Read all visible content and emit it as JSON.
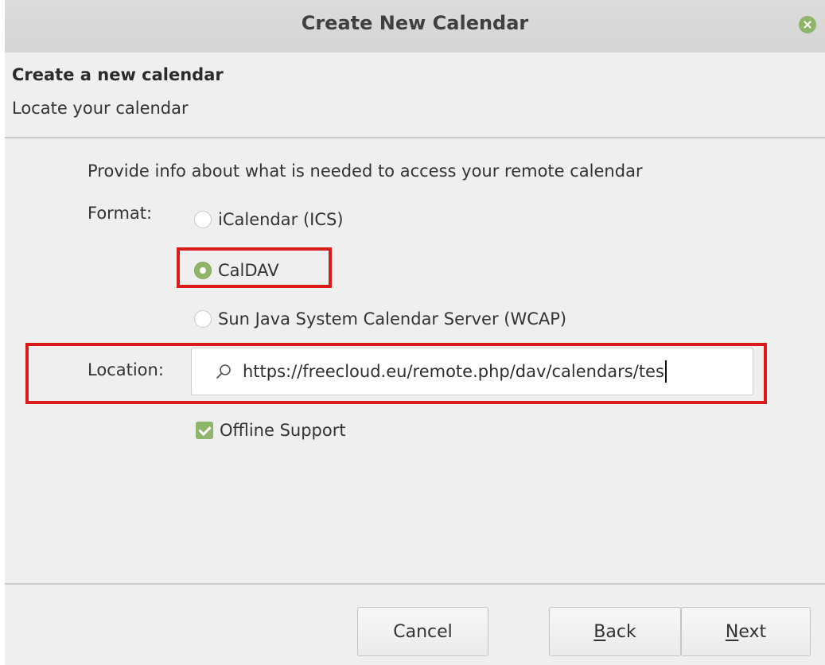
{
  "window": {
    "title": "Create New Calendar"
  },
  "header": {
    "title": "Create a new calendar",
    "subtitle": "Locate your calendar"
  },
  "form": {
    "intro": "Provide info about what is needed to access your remote calendar",
    "format_label": "Format:",
    "formats": [
      {
        "label": "iCalendar (ICS)",
        "checked": false
      },
      {
        "label": "CalDAV",
        "checked": true
      },
      {
        "label": "Sun Java System Calendar Server (WCAP)",
        "checked": false
      }
    ],
    "location_label": "Location:",
    "location_value": "https://freecloud.eu/remote.php/dav/calendars/tes",
    "offline_label": "Offline Support",
    "offline_checked": true
  },
  "buttons": {
    "cancel": "Cancel",
    "back_first": "B",
    "back_rest": "ack",
    "next_first": "N",
    "next_rest": "ext"
  },
  "colors": {
    "accent": "#8fb56a",
    "highlight": "#d81b1b"
  },
  "icons": {
    "close": "close-icon",
    "search": "search-icon"
  }
}
